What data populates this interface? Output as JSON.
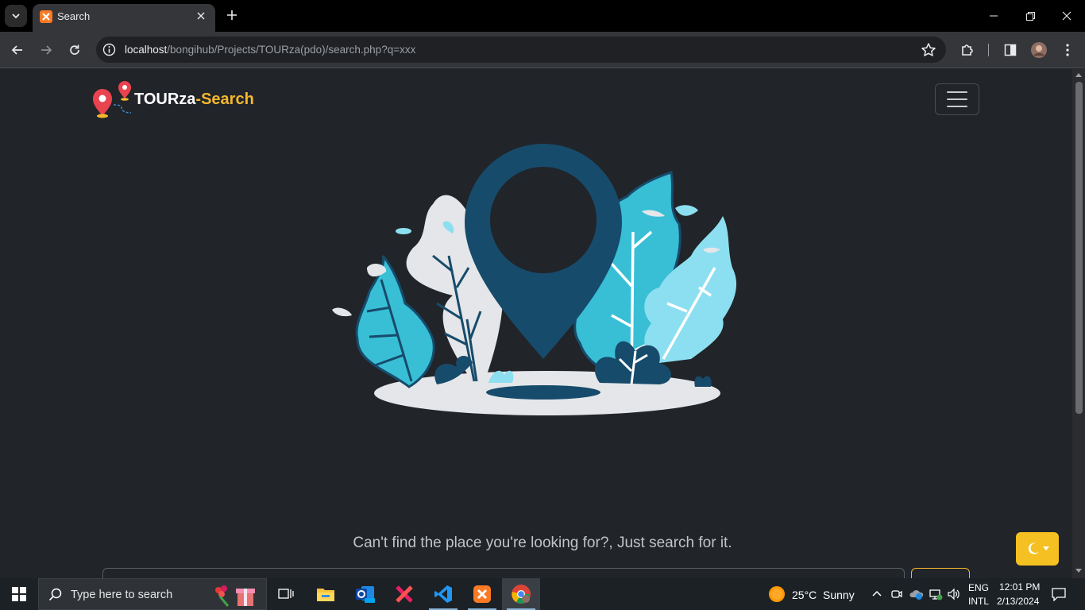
{
  "browser": {
    "tab": {
      "title": "Search"
    },
    "url": {
      "host": "localhost",
      "path": "/bongihub/Projects/TOURza(pdo)/search.php?q=xxx"
    }
  },
  "page": {
    "brand": {
      "name": "TOURza",
      "separator": "-",
      "accent": "Search"
    },
    "tagline": "Can't find the place you're looking for?, Just search for it.",
    "search": {
      "placeholder": ""
    },
    "colors": {
      "background": "#212428",
      "accent": "#f5b82e",
      "pin": "#174b6b",
      "leaf_cyan": "#38bfd6",
      "leaf_light": "#8cdff0",
      "leaf_grey": "#e4e6e9"
    }
  },
  "taskbar": {
    "search_placeholder": "Type here to search",
    "weather": {
      "temp": "25°C",
      "condition": "Sunny"
    },
    "language": {
      "line1": "ENG",
      "line2": "INTL"
    },
    "clock": {
      "time": "12:01 PM",
      "date": "2/13/2024"
    },
    "apps": [
      "task-view",
      "file-explorer",
      "outlook-new",
      "xampp-red",
      "vscode",
      "xampp",
      "chrome"
    ]
  }
}
